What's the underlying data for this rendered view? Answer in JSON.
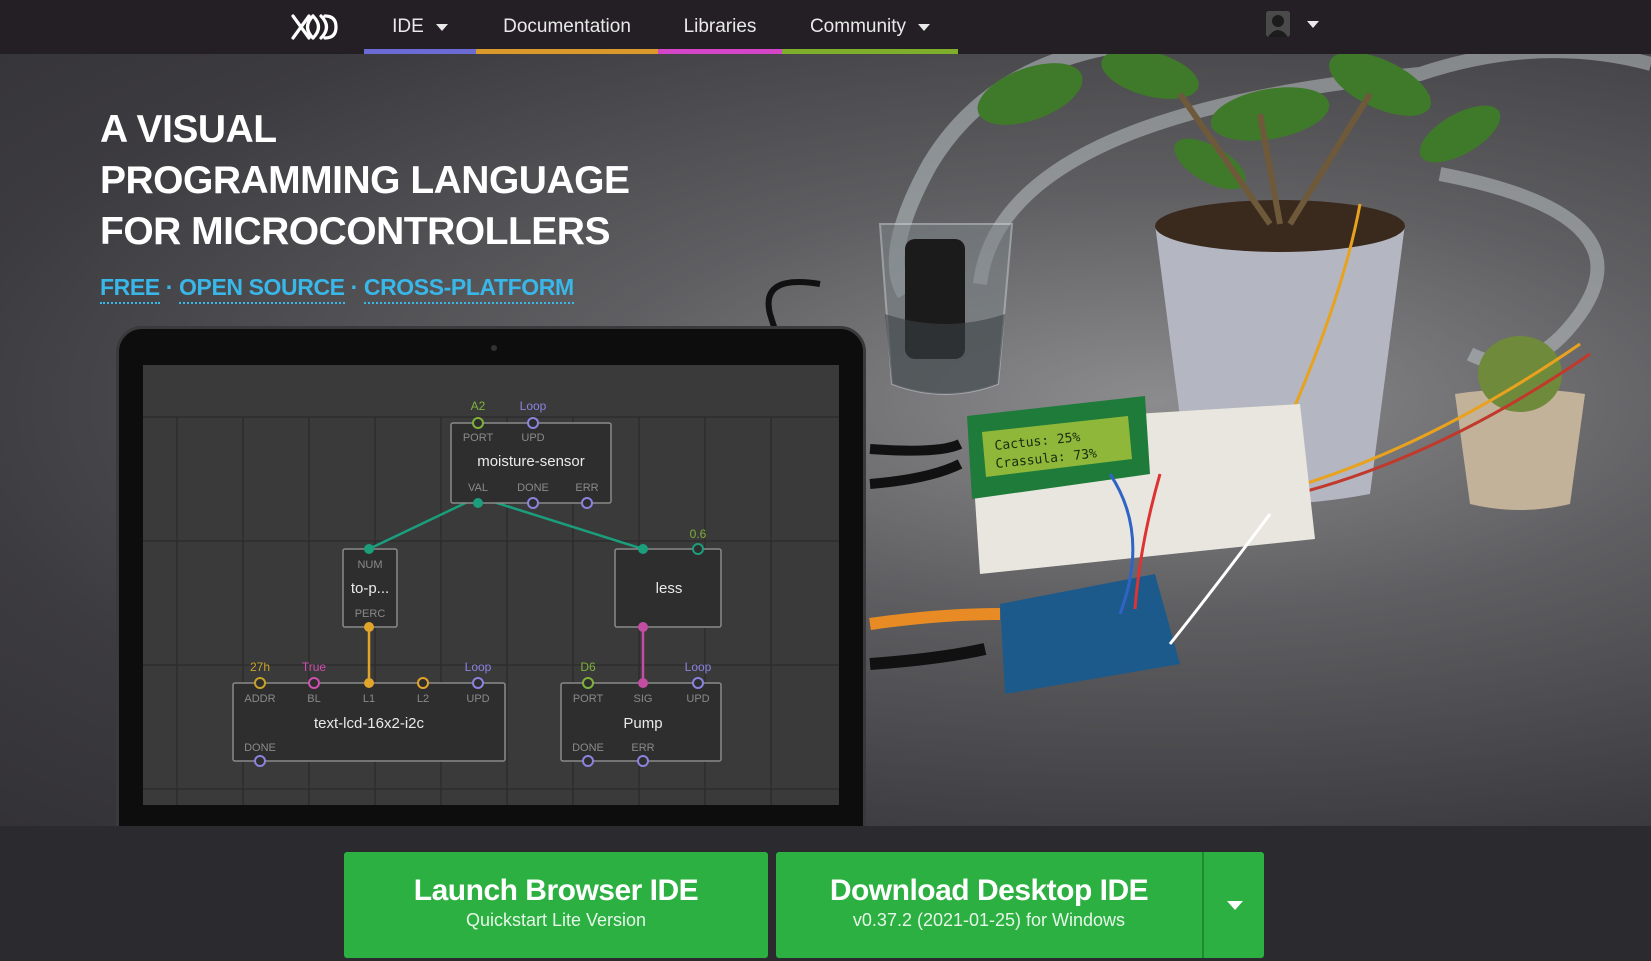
{
  "nav": {
    "logo": "XOD",
    "items": [
      {
        "label": "IDE",
        "has_dropdown": true,
        "accent": "#6b6bd6"
      },
      {
        "label": "Documentation",
        "has_dropdown": false,
        "accent": "#d99a2b"
      },
      {
        "label": "Libraries",
        "has_dropdown": false,
        "accent": "#d445c8"
      },
      {
        "label": "Community",
        "has_dropdown": true,
        "accent": "#7fae2c"
      }
    ]
  },
  "hero": {
    "headline": [
      "A VISUAL",
      "PROGRAMMING LANGUAGE",
      "FOR MICROCONTROLLERS"
    ],
    "tagline": [
      "FREE",
      "OPEN SOURCE",
      "CROSS-PLATFORM"
    ],
    "tagline_separator": "·"
  },
  "patch": {
    "moisture": {
      "title": "moisture-sensor",
      "pins_top": [
        "PORT",
        "UPD"
      ],
      "pin_values_top": [
        "A2",
        "Loop"
      ],
      "pins_bottom": [
        "VAL",
        "DONE",
        "ERR"
      ]
    },
    "topercent": {
      "title": "to-p...",
      "pin_top": "NUM",
      "pin_bottom": "PERC"
    },
    "less": {
      "title": "less",
      "value": "0.6"
    },
    "lcd": {
      "title": "text-lcd-16x2-i2c",
      "pins_top": [
        "ADDR",
        "BL",
        "L1",
        "L2",
        "UPD"
      ],
      "pin_values_top": [
        "27h",
        "True",
        "",
        "",
        "Loop"
      ],
      "pins_bottom": [
        "DONE"
      ]
    },
    "pump": {
      "title": "Pump",
      "pins_top": [
        "PORT",
        "SIG",
        "UPD"
      ],
      "pin_values_top": [
        "D6",
        "",
        "Loop"
      ],
      "pins_bottom": [
        "DONE",
        "ERR"
      ]
    }
  },
  "lcd_display": {
    "line1": "Cactus: 25%",
    "line2": "Crassula: 73%"
  },
  "buttons": {
    "launch": {
      "label": "Launch Browser IDE",
      "sub": "Quickstart Lite Version"
    },
    "download": {
      "label": "Download Desktop IDE",
      "sub": "v0.37.2 (2021-01-25) for Windows"
    }
  },
  "colors": {
    "brand_green": "#2cb041",
    "tagline_blue": "#38b7e8",
    "nav_bg": "#231f24"
  }
}
